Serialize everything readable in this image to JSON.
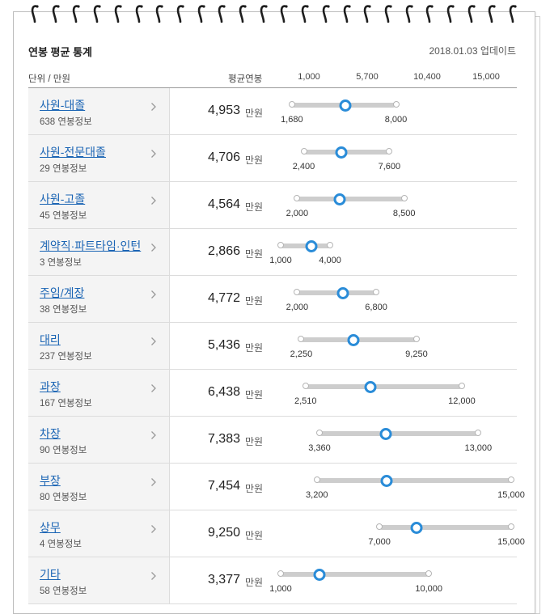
{
  "header": {
    "title": "연봉 평균 통계",
    "updated": "2018.01.03 업데이트",
    "unit_label": "단위 / 만원",
    "avg_label": "평균연봉",
    "scale_ticks": [
      "1,000",
      "5,700",
      "10,400",
      "15,000"
    ]
  },
  "unit_word": "만원",
  "rows": [
    {
      "position": "사원-대졸",
      "count": "638 연봉정보",
      "avg": "4,953",
      "min": "1,680",
      "max": "8,000",
      "avg_value": 4953,
      "min_value": 1680,
      "max_value": 8000
    },
    {
      "position": "사원-전문대졸",
      "count": "29 연봉정보",
      "avg": "4,706",
      "min": "2,400",
      "max": "7,600",
      "avg_value": 4706,
      "min_value": 2400,
      "max_value": 7600
    },
    {
      "position": "사원-고졸",
      "count": "45 연봉정보",
      "avg": "4,564",
      "min": "2,000",
      "max": "8,500",
      "avg_value": 4564,
      "min_value": 2000,
      "max_value": 8500
    },
    {
      "position": "계약직·파트타임·인턴",
      "count": "3 연봉정보",
      "avg": "2,866",
      "min": "1,000",
      "max": "4,000",
      "avg_value": 2866,
      "min_value": 1000,
      "max_value": 4000
    },
    {
      "position": "주임/계장",
      "count": "38 연봉정보",
      "avg": "4,772",
      "min": "2,000",
      "max": "6,800",
      "avg_value": 4772,
      "min_value": 2000,
      "max_value": 6800
    },
    {
      "position": "대리",
      "count": "237 연봉정보",
      "avg": "5,436",
      "min": "2,250",
      "max": "9,250",
      "avg_value": 5436,
      "min_value": 2250,
      "max_value": 9250
    },
    {
      "position": "과장",
      "count": "167 연봉정보",
      "avg": "6,438",
      "min": "2,510",
      "max": "12,000",
      "avg_value": 6438,
      "min_value": 2510,
      "max_value": 12000
    },
    {
      "position": "차장",
      "count": "90 연봉정보",
      "avg": "7,383",
      "min": "3,360",
      "max": "13,000",
      "avg_value": 7383,
      "min_value": 3360,
      "max_value": 13000
    },
    {
      "position": "부장",
      "count": "80 연봉정보",
      "avg": "7,454",
      "min": "3,200",
      "max": "15,000",
      "avg_value": 7454,
      "min_value": 3200,
      "max_value": 15000
    },
    {
      "position": "상무",
      "count": "4 연봉정보",
      "avg": "9,250",
      "min": "7,000",
      "max": "15,000",
      "avg_value": 9250,
      "min_value": 7000,
      "max_value": 15000
    },
    {
      "position": "기타",
      "count": "58 연봉정보",
      "avg": "3,377",
      "min": "1,000",
      "max": "10,000",
      "avg_value": 3377,
      "min_value": 1000,
      "max_value": 10000
    }
  ],
  "colors": {
    "link": "#1a64b4",
    "marker": "#2a8cd8",
    "track": "#cdcdcd"
  },
  "icons": {
    "row_arrow": "chevron-right-icon",
    "binding": "spiral-ring-icon"
  }
}
